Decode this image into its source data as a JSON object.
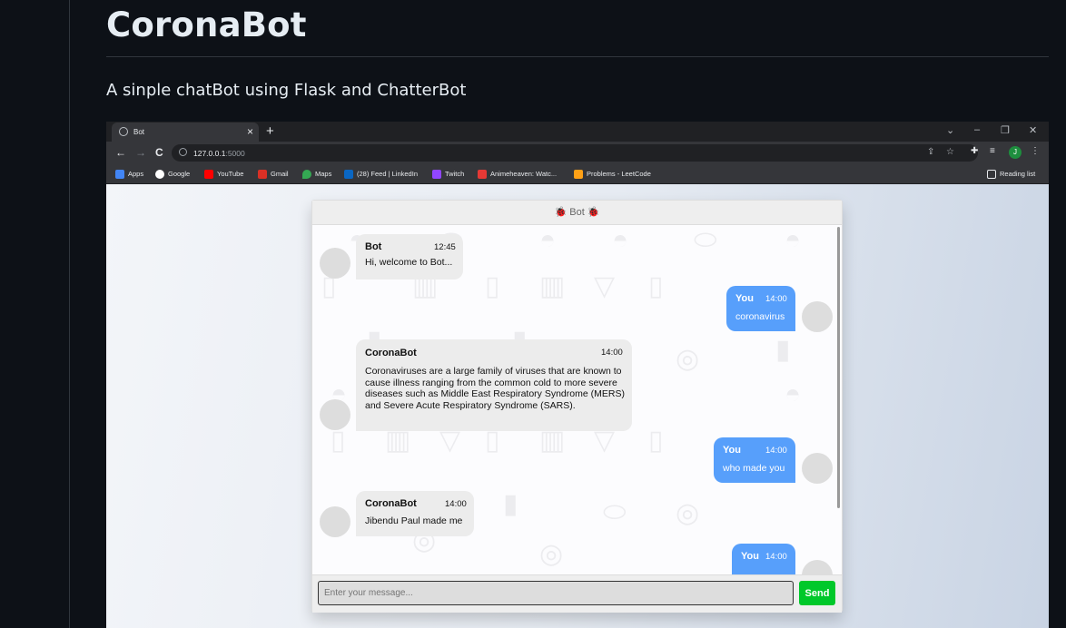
{
  "readme": {
    "title": "CoronaBot",
    "description": "A sinple chatBot using Flask and ChatterBot"
  },
  "browser": {
    "tab_title": "Bot",
    "tab_close": "×",
    "new_tab": "+",
    "window_controls": [
      "⌄",
      "–",
      "❐",
      "✕"
    ],
    "nav": {
      "back": "←",
      "forward": "→",
      "reload": "C"
    },
    "url_host": "127.0.0.1",
    "url_port": ":5000",
    "profile_initial": "J",
    "bookmarks": [
      {
        "label": "Apps",
        "color": "#ea4335"
      },
      {
        "label": "Google",
        "color": "#4285f4"
      },
      {
        "label": "YouTube",
        "color": "#ff0000"
      },
      {
        "label": "Gmail",
        "color": "#d93025"
      },
      {
        "label": "Maps",
        "color": "#34a853"
      },
      {
        "label": "(28) Feed | LinkedIn",
        "color": "#0a66c2"
      },
      {
        "label": "Twitch",
        "color": "#9146ff"
      },
      {
        "label": "Animeheaven: Watc...",
        "color": "#e53935"
      },
      {
        "label": "Problems - LeetCode",
        "color": "#ffa116"
      }
    ],
    "reading_list": "Reading list"
  },
  "chat": {
    "header": "🐞 Bot 🐞",
    "messages": [
      {
        "side": "left",
        "name": "Bot",
        "time": "12:45",
        "text": "Hi, welcome to Bot..."
      },
      {
        "side": "right",
        "name": "You",
        "time": "14:00",
        "text": "coronavirus"
      },
      {
        "side": "left",
        "name": "CoronaBot",
        "time": "14:00",
        "text": "Coronaviruses are a large family of viruses that are known to cause illness ranging from the common cold to more severe diseases such as Middle East Respiratory Syndrome (MERS) and Severe Acute Respiratory Syndrome (SARS)."
      },
      {
        "side": "right",
        "name": "You",
        "time": "14:00",
        "text": "who made you"
      },
      {
        "side": "left",
        "name": "CoronaBot",
        "time": "14:00",
        "text": "Jibendu Paul made me"
      },
      {
        "side": "right",
        "name": "You",
        "time": "14:00",
        "text": ""
      }
    ],
    "input_placeholder": "Enter your message...",
    "send_label": "Send"
  }
}
